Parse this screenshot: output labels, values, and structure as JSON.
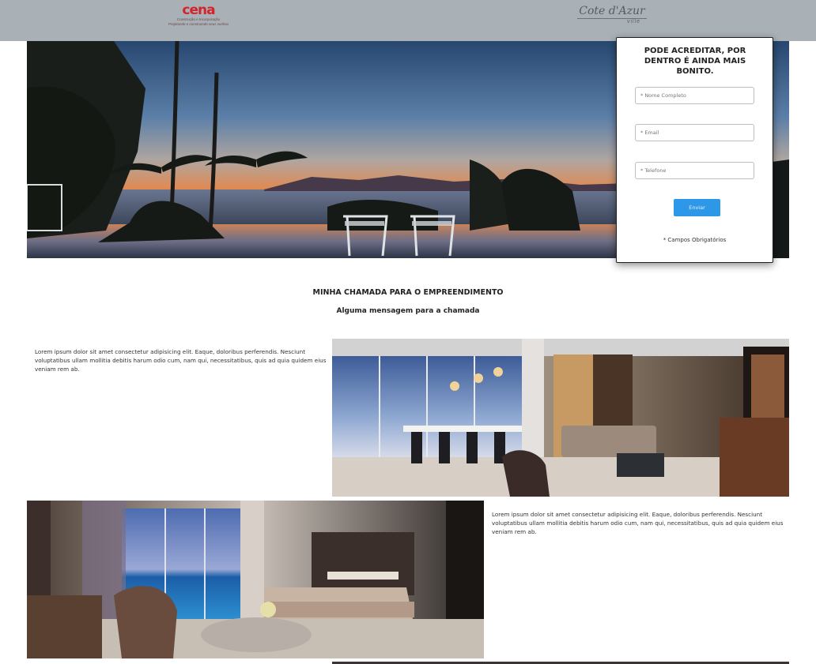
{
  "header": {
    "brand_left": {
      "name": "cena",
      "line1": "Construção e Incorporação",
      "line2": "Projetando e construindo seus sonhos"
    },
    "brand_right": {
      "name": "Cote d'Azur",
      "suffix": "ville"
    }
  },
  "form": {
    "title": "PODE ACREDITAR, POR DENTRO É AINDA MAIS BONITO.",
    "fields": {
      "name_placeholder": "* Nome Completo",
      "email_placeholder": "* Email",
      "phone_placeholder": "* Telefone"
    },
    "submit_label": "Enviar",
    "required_note": "* Campos Obrigatórios"
  },
  "section": {
    "title": "MINHA CHAMADA PARA O EMPREENDIMENTO",
    "subtitle": "Alguma mensagem para a chamada"
  },
  "blocks": [
    {
      "text": "Lorem ipsum dolor sit amet consectetur adipisicing elit. Eaque, doloribus perferendis. Nesciunt voluptatibus ullam mollitia debitis harum odio cum, nam qui, necessitatibus, quis ad quia quidem eius veniam rem ab."
    },
    {
      "text": "Lorem ipsum dolor sit amet consectetur adipisicing elit. Eaque, doloribus perferendis. Nesciunt voluptatibus ullam mollitia debitis harum odio cum, nam qui, necessitatibus, quis ad quia quidem eius veniam rem ab."
    }
  ],
  "colors": {
    "topbar": "#a9b0b6",
    "brand_red": "#d3242b",
    "button_blue": "#2d97e8"
  }
}
